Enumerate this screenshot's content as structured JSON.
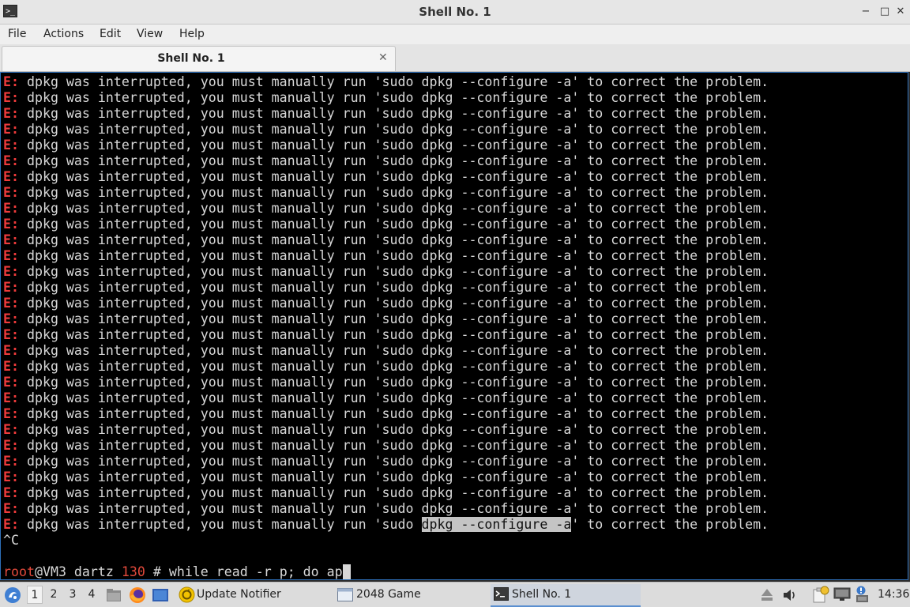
{
  "window": {
    "title": "Shell No. 1",
    "minimize_glyph": "−",
    "maximize_glyph": "□",
    "close_glyph": "✕",
    "app_icon_glyph": ">_"
  },
  "menubar": {
    "items": [
      "File",
      "Actions",
      "Edit",
      "View",
      "Help"
    ]
  },
  "tabs": [
    {
      "label": "Shell No. 1",
      "close_glyph": "✕"
    }
  ],
  "terminal": {
    "error_prefix": "E:",
    "error_pre": " dpkg was interrupted, you must manually run 'sudo ",
    "error_mid": "dpkg --configure -a",
    "error_post": "' to correct the problem.",
    "error_line_count": 29,
    "interrupt_line": "^C",
    "prompt_user": "root",
    "prompt_host": "@VM3",
    "prompt_dir": " dartz",
    "prompt_code": " 130",
    "prompt_hash": " #",
    "command": " while read -r p; do ap"
  },
  "taskbar": {
    "workspaces": [
      "1",
      "2",
      "3",
      "4"
    ],
    "active_workspace": "1",
    "tasks": [
      {
        "label": "Update Notifier",
        "icon": "update-notifier-icon"
      },
      {
        "label": "2048 Game",
        "icon": "game-window-icon"
      },
      {
        "label": "Shell No. 1",
        "icon": "terminal-icon",
        "active": true
      }
    ],
    "clock": "14:36"
  },
  "colors": {
    "terminal_bg": "#000000",
    "terminal_fg": "#d8d8d8",
    "error_red": "#ef3b3b",
    "selection_bg": "#c4c4c4",
    "window_border": "#2d6fb8"
  }
}
